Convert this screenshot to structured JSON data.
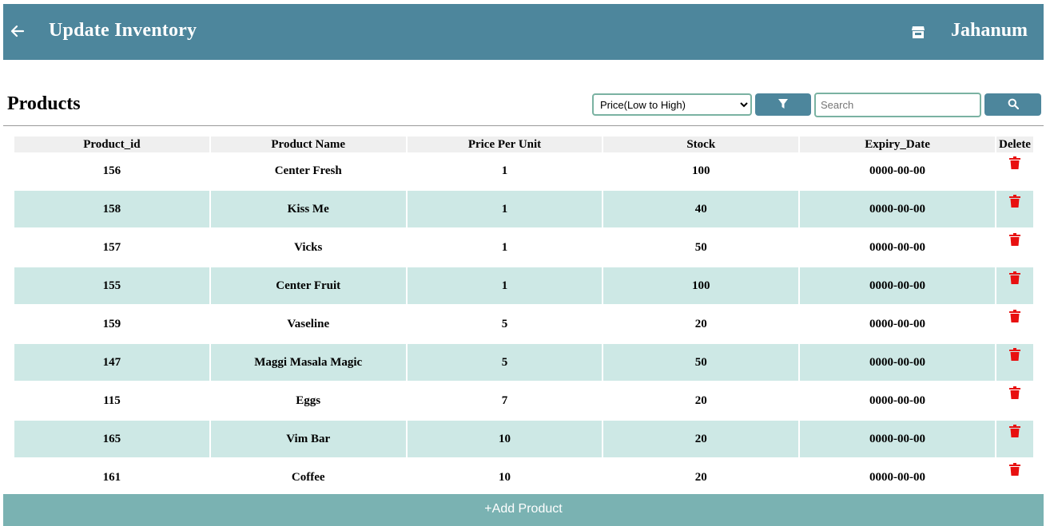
{
  "header": {
    "title": "Update Inventory",
    "user": "Jahanum"
  },
  "main": {
    "section_title": "Products",
    "sort": {
      "selected": "Price(Low to High)"
    },
    "search": {
      "placeholder": "Search"
    },
    "table": {
      "columns": [
        "Product_id",
        "Product Name",
        "Price Per Unit",
        "Stock",
        "Expiry_Date",
        "Delete"
      ],
      "rows": [
        {
          "id": "156",
          "name": "Center Fresh",
          "price": "1",
          "stock": "100",
          "expiry": "0000-00-00"
        },
        {
          "id": "158",
          "name": "Kiss Me",
          "price": "1",
          "stock": "40",
          "expiry": "0000-00-00"
        },
        {
          "id": "157",
          "name": "Vicks",
          "price": "1",
          "stock": "50",
          "expiry": "0000-00-00"
        },
        {
          "id": "155",
          "name": "Center Fruit",
          "price": "1",
          "stock": "100",
          "expiry": "0000-00-00"
        },
        {
          "id": "159",
          "name": "Vaseline",
          "price": "5",
          "stock": "20",
          "expiry": "0000-00-00"
        },
        {
          "id": "147",
          "name": "Maggi Masala Magic",
          "price": "5",
          "stock": "50",
          "expiry": "0000-00-00"
        },
        {
          "id": "115",
          "name": "Eggs",
          "price": "7",
          "stock": "20",
          "expiry": "0000-00-00"
        },
        {
          "id": "165",
          "name": "Vim Bar",
          "price": "10",
          "stock": "20",
          "expiry": "0000-00-00"
        },
        {
          "id": "161",
          "name": "Coffee",
          "price": "10",
          "stock": "20",
          "expiry": "0000-00-00"
        }
      ]
    }
  },
  "footer": {
    "add_label": "+Add Product"
  },
  "icons": {
    "back": "arrow-left-icon",
    "store": "store-icon",
    "filter": "filter-icon",
    "search": "search-icon",
    "delete": "trash-icon"
  },
  "colors": {
    "header_bg": "#4d869c",
    "row_alt": "#cde8e5",
    "accent_border": "#7ab2a2",
    "add_bar": "#7ab2b2",
    "delete_icon": "#e81010"
  }
}
